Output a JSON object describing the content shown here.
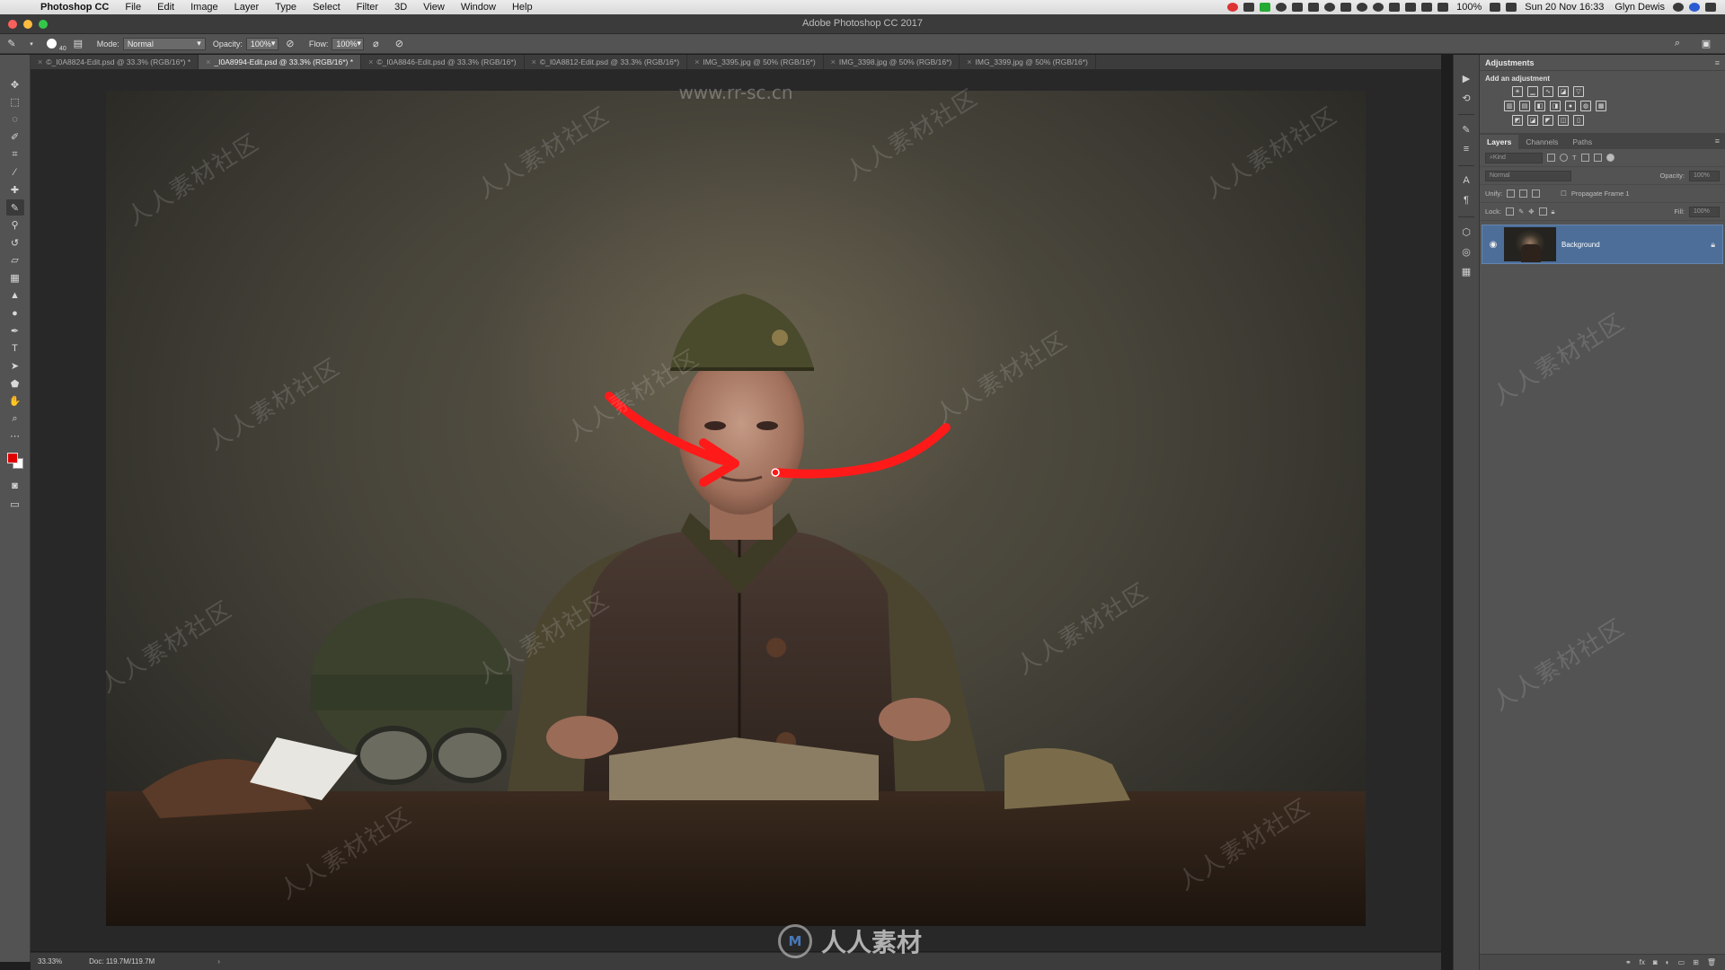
{
  "menubar": {
    "app_name": "Photoshop CC",
    "items": [
      "File",
      "Edit",
      "Image",
      "Layer",
      "Type",
      "Select",
      "Filter",
      "3D",
      "View",
      "Window",
      "Help"
    ],
    "battery": "100%",
    "datetime": "Sun 20 Nov  16:33",
    "user": "Glyn Dewis"
  },
  "window": {
    "title": "Adobe Photoshop CC 2017"
  },
  "options_bar": {
    "brush_size": "40",
    "mode_label": "Mode:",
    "mode_value": "Normal",
    "opacity_label": "Opacity:",
    "opacity_value": "100%",
    "flow_label": "Flow:",
    "flow_value": "100%"
  },
  "tabs": [
    {
      "label": "©_I0A8824-Edit.psd @ 33.3% (RGB/16*) *"
    },
    {
      "label": "_I0A8994-Edit.psd @ 33.3% (RGB/16*) *"
    },
    {
      "label": "©_I0A8846-Edit.psd @ 33.3% (RGB/16*)"
    },
    {
      "label": "©_I0A8812-Edit.psd @ 33.3% (RGB/16*)"
    },
    {
      "label": "IMG_3395.jpg @ 50% (RGB/16*)"
    },
    {
      "label": "IMG_3398.jpg @ 50% (RGB/16*)"
    },
    {
      "label": "IMG_3399.jpg @ 50% (RGB/16*)"
    }
  ],
  "status": {
    "zoom": "33.33%",
    "doc": "Doc: 119.7M/119.7M"
  },
  "adjustments": {
    "title": "Adjustments",
    "subtitle": "Add an adjustment"
  },
  "layers_panel": {
    "tabs": [
      "Layers",
      "Channels",
      "Paths"
    ],
    "kind_placeholder": "Kind",
    "blend_mode": "Normal",
    "opacity_label": "Opacity:",
    "opacity_value": "100%",
    "unify_label": "Unify:",
    "propagate_label": "Propagate Frame 1",
    "lock_label": "Lock:",
    "fill_label": "Fill:",
    "fill_value": "100%",
    "layer_name": "Background"
  },
  "colors": {
    "foreground": "#e00000",
    "background": "#ffffff",
    "annotation": "#ff1a1a",
    "selection": "#4c6e99"
  },
  "watermark": {
    "url": "www.rr-sc.cn",
    "tile": "人人素材社区",
    "logo_text": "人人素材"
  }
}
